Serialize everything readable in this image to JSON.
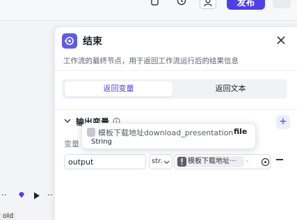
{
  "toolbar": {
    "publish_label": "发布",
    "icons": [
      "copy-icon",
      "history-icon",
      "user-icon"
    ]
  },
  "panel": {
    "title": "结束",
    "description": "工作流的最终节点，用于返回工作流运行后的结果信息",
    "tabs": [
      {
        "label": "返回变量",
        "active": true
      },
      {
        "label": "返回文本",
        "active": false
      }
    ],
    "section_title": "输出变量",
    "variable_label": "变量",
    "add_label": "+",
    "row": {
      "name": "output",
      "type_short": "str.",
      "ref_chip": "模板下载地址···",
      "ref_dash": "-"
    }
  },
  "tooltip": {
    "var_name": "模板下载地址download_presentation",
    "sep": "·",
    "type": "file",
    "subtype": "String"
  },
  "canvas": {
    "bottom_label": "old"
  },
  "colors": {
    "accent": "#4e40e5",
    "node_icon": "#5f5ce6",
    "panel_bg": "#ffffff",
    "canvas_bg": "#f3f4f8"
  }
}
